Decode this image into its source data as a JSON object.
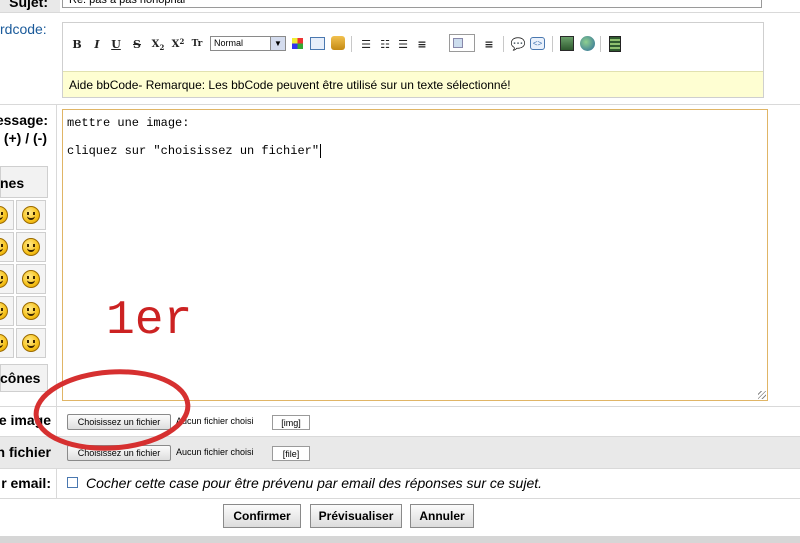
{
  "rows": {
    "sujet_label": "Sujet:",
    "sujet_value": "Re: pas à pas nonopnal",
    "bbcode_label": "rdcode:",
    "message_label_1": "essage:",
    "message_label_2": "(+) / (-)",
    "emoticons_header": "nes",
    "emoticons_footer": "cônes",
    "image_label": "e image",
    "file_label": "n fichier",
    "email_label": "r email:"
  },
  "toolbar": {
    "font_size_value": "Normal"
  },
  "help_bar": {
    "text": "Aide  bbCode- Remarque: Les bbCode peuvent être utilisé sur un texte sélectionné!"
  },
  "message": {
    "line1": "mettre une image:",
    "line2": "",
    "line3": "cliquez sur \"choisissez un fichier\""
  },
  "annotation": {
    "text": "1er",
    "color": "#cc2222"
  },
  "upload_image": {
    "button": "Choisissez un fichier",
    "status": "Aucun fichier choisi",
    "tag": "[img]"
  },
  "upload_file": {
    "button": "Choisissez un fichier",
    "status": "Aucun fichier choisi",
    "tag": "[file]"
  },
  "notify": {
    "label": "Cocher cette case pour être prévenu par email des réponses sur ce sujet."
  },
  "actions": {
    "confirm": "Confirmer",
    "preview": "Prévisualiser",
    "cancel": "Annuler"
  },
  "colors": {
    "link_blue": "#1a5a9a",
    "help_bg": "#fefed2",
    "textarea_border": "#e0b566",
    "circle_red": "#d63030"
  }
}
